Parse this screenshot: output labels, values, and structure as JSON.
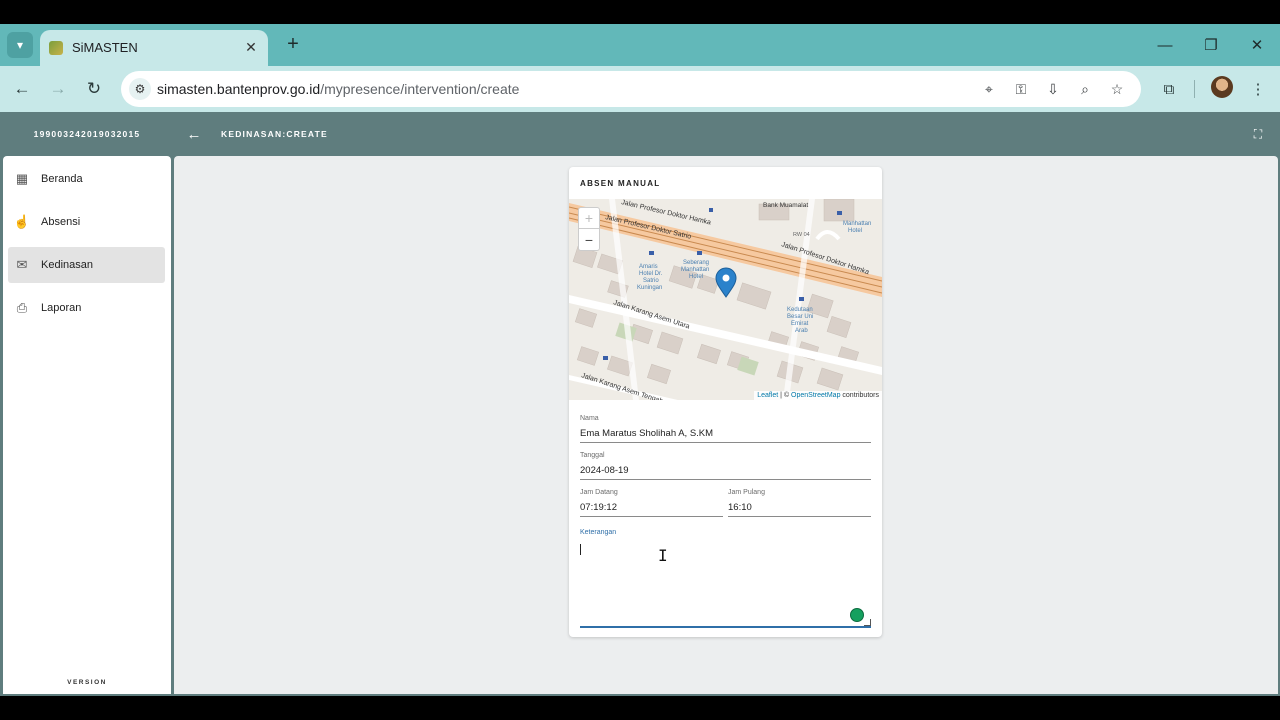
{
  "browser": {
    "tab_title": "SiMASTEN",
    "url_host": "simasten.bantenprov.go.id",
    "url_path": "/mypresence/intervention/create"
  },
  "sidebar": {
    "user_id": "199003242019032015",
    "items": [
      {
        "label": "Beranda",
        "icon": "dashboard-icon",
        "active": false
      },
      {
        "label": "Absensi",
        "icon": "touch-icon",
        "active": false
      },
      {
        "label": "Kedinasan",
        "icon": "mail-icon",
        "active": true
      },
      {
        "label": "Laporan",
        "icon": "printer-icon",
        "active": false
      }
    ],
    "version_label": "VERSION"
  },
  "header": {
    "title": "KEDINASAN:CREATE"
  },
  "card": {
    "title": "ABSEN MANUAL",
    "map": {
      "zoom_in": "+",
      "zoom_out": "−",
      "attribution_leaflet": "Leaflet",
      "attribution_sep": " | © ",
      "attribution_osm": "OpenStreetMap",
      "attribution_tail": " contributors",
      "labels": {
        "road1": "Jalan Profesor Doktor Hamka",
        "road2": "Jalan Profesor Doktor Satrio",
        "road3": "Jalan Profesor Doktor Hamka",
        "road4": "Jalan Karang Asem Utara",
        "road5": "Jalan Karang Asem Tengah",
        "poi1": "Bank Muamalat",
        "poi2": "Manhattan",
        "poi2b": "Hotel",
        "poi3": "Amaris",
        "poi3b": "Hotel Dr.",
        "poi3c": "Satrio",
        "poi3d": "Kuningan",
        "poi4": "Seberang",
        "poi4b": "Manhattan",
        "poi4c": "Hotel",
        "poi5": "Kedutaan",
        "poi5b": "Besar Uni",
        "poi5c": "Emirat",
        "poi5d": "Arab",
        "rw": "RW 04"
      }
    },
    "fields": {
      "nama_label": "Nama",
      "nama_value": "Ema Maratus Sholihah A, S.KM",
      "tanggal_label": "Tanggal",
      "tanggal_value": "2024-08-19",
      "jam_datang_label": "Jam Datang",
      "jam_datang_value": "07:19:12",
      "jam_pulang_label": "Jam Pulang",
      "jam_pulang_value": "16:10",
      "keterangan_label": "Keterangan",
      "keterangan_value": ""
    }
  },
  "colors": {
    "accent": "#2f6fa8",
    "header_bg": "#5f7d7e",
    "browser_bg": "#62b8b9"
  }
}
